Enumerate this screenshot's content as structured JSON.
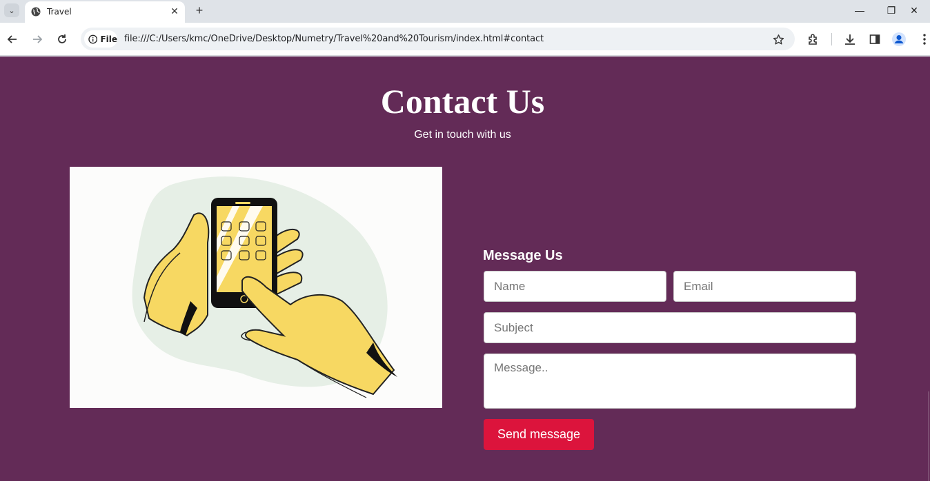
{
  "browser": {
    "tab_title": "Travel",
    "security_chip": "File",
    "url": "file:///C:/Users/kmc/OneDrive/Desktop/Numetry/Travel%20and%20Tourism/index.html#contact",
    "icons": [
      "tab-search-icon",
      "globe-icon",
      "close-icon",
      "plus-icon",
      "minimize-icon",
      "restore-icon",
      "close-window-icon",
      "back-arrow-icon",
      "forward-arrow-icon",
      "reload-icon",
      "info-icon",
      "star-icon",
      "extensions-icon",
      "download-icon",
      "side-panel-icon",
      "profile-icon",
      "kebab-menu-icon"
    ]
  },
  "contact": {
    "title": "Contact Us",
    "subtitle": "Get in touch with us",
    "form_title": "Message Us",
    "name_placeholder": "Name",
    "email_placeholder": "Email",
    "subject_placeholder": "Subject",
    "message_placeholder": "Message..",
    "send_label": "Send message"
  },
  "colors": {
    "page_background": "#632b57",
    "button": "#dc143c",
    "illustration_yellow": "#f7d862",
    "illustration_blob": "#e6efe6"
  }
}
